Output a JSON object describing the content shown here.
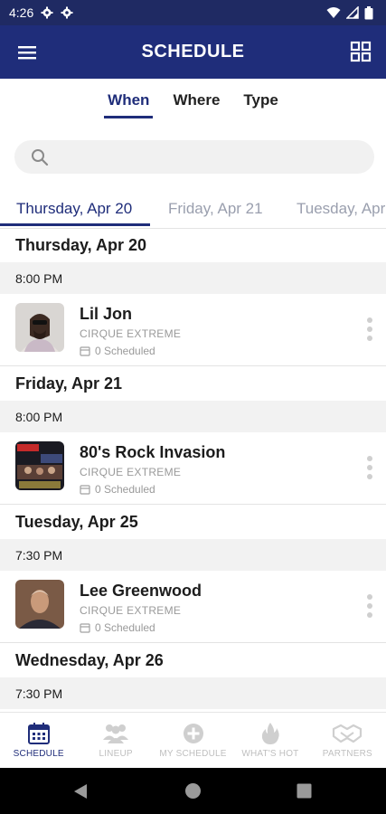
{
  "status_bar": {
    "time": "4:26"
  },
  "app_bar": {
    "title": "SCHEDULE"
  },
  "top_tabs": [
    {
      "label": "When",
      "active": true
    },
    {
      "label": "Where",
      "active": false
    },
    {
      "label": "Type",
      "active": false
    }
  ],
  "date_tabs": [
    {
      "label": "Thursday, Apr 20",
      "active": true
    },
    {
      "label": "Friday, Apr 21",
      "active": false
    },
    {
      "label": "Tuesday, Apr",
      "active": false
    }
  ],
  "days": [
    {
      "date": "Thursday, Apr 20",
      "time": "8:00 PM",
      "event": {
        "name": "Lil Jon",
        "venue": "CIRQUE EXTREME",
        "scheduled": "0 Scheduled"
      }
    },
    {
      "date": "Friday, Apr 21",
      "time": "8:00 PM",
      "event": {
        "name": "80's Rock Invasion",
        "venue": "CIRQUE EXTREME",
        "scheduled": "0 Scheduled"
      }
    },
    {
      "date": "Tuesday, Apr 25",
      "time": "7:30 PM",
      "event": {
        "name": "Lee Greenwood",
        "venue": "CIRQUE EXTREME",
        "scheduled": "0 Scheduled"
      }
    },
    {
      "date": "Wednesday, Apr 26",
      "time": "7:30 PM"
    }
  ],
  "bottom_nav": [
    {
      "label": "SCHEDULE",
      "icon": "calendar-icon",
      "active": true
    },
    {
      "label": "LINEUP",
      "icon": "people-icon",
      "active": false
    },
    {
      "label": "MY SCHEDULE",
      "icon": "plus-circle-icon",
      "active": false
    },
    {
      "label": "WHAT'S HOT",
      "icon": "flame-icon",
      "active": false
    },
    {
      "label": "PARTNERS",
      "icon": "handshake-icon",
      "active": false
    }
  ],
  "colors": {
    "brand": "#1f2d7a",
    "inactive": "#bfbfbf",
    "section_bg": "#f2f2f2"
  }
}
